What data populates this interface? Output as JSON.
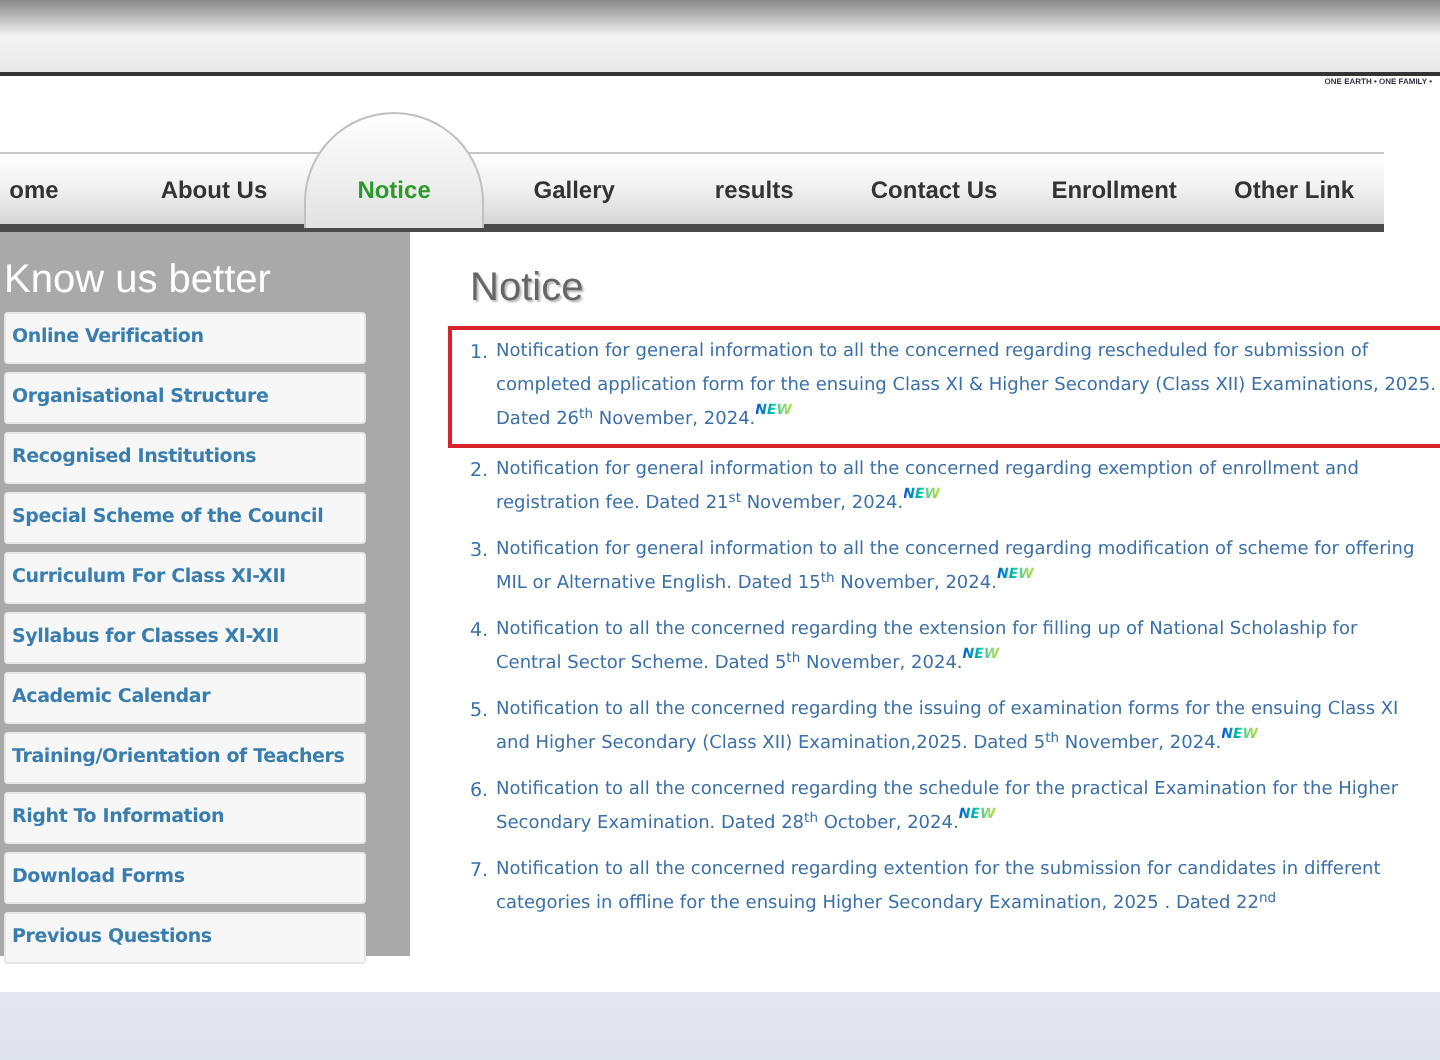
{
  "header": {
    "tagline": "ONE EARTH • ONE FAMILY •"
  },
  "nav": [
    {
      "label": "ome",
      "selected": false
    },
    {
      "label": "About Us",
      "selected": false
    },
    {
      "label": "Notice",
      "selected": true
    },
    {
      "label": "Gallery",
      "selected": false
    },
    {
      "label": "results",
      "selected": false
    },
    {
      "label": "Contact Us",
      "selected": false
    },
    {
      "label": "Enrollment",
      "selected": false
    },
    {
      "label": "Other Link",
      "selected": false
    }
  ],
  "sidebar": {
    "title": "Know us better",
    "items": [
      "Online Verification",
      "Organisational Structure",
      "Recognised Institutions",
      "Special Scheme of the Council",
      "Curriculum For Class XI-XII",
      "Syllabus for Classes XI-XII",
      "Academic Calendar",
      "Training/Orientation of Teachers",
      "Right To Information",
      "Download Forms",
      "Previous Questions"
    ]
  },
  "content": {
    "title": "Notice",
    "notices": [
      {
        "number": "1.",
        "text": "Notification for general information to all the concerned regarding rescheduled for submission of completed application form for the ensuing Class XI & Higher Secondary (Class XII) Examinations, 2025. Dated 26$^{th}$ November, 2024.",
        "badge": "NEW",
        "highlighted": true
      },
      {
        "number": "2.",
        "text": "Notification for general information to all the concerned regarding exemption of enrollment and registration fee. Dated 21$^{st}$ November, 2024.",
        "badge": "NEW",
        "highlighted": false
      },
      {
        "number": "3.",
        "text": "Notification for general information to all the concerned regarding modification of scheme for offering MIL or Alternative English. Dated 15$^{th}$ November, 2024.",
        "badge": "NEW",
        "highlighted": false
      },
      {
        "number": "4.",
        "text": "Notification to all the concerned regarding the extension for filling up of National Scholaship for Central Sector Scheme. Dated 5$^{th}$ November, 2024.",
        "badge": "NEW",
        "highlighted": false
      },
      {
        "number": "5.",
        "text": "Notification to all the concerned regarding the issuing of examination forms for the ensuing Class XI and Higher Secondary (Class XII) Examination,2025. Dated 5$^{th}$ November, 2024.",
        "badge": "NEW",
        "highlighted": false
      },
      {
        "number": "6.",
        "text": "Notification to all the concerned regarding the schedule for the practical Examination for the Higher Secondary Examination. Dated 28$^{th}$ October, 2024.",
        "badge": "NEW",
        "highlighted": false
      },
      {
        "number": "7.",
        "text": "Notification to all the concerned regarding extention for the submission for candidates in different categories in offline for the ensuing Higher Secondary Examination, 2025 . Dated 22$^{nd}$",
        "highlighted": false
      }
    ]
  }
}
